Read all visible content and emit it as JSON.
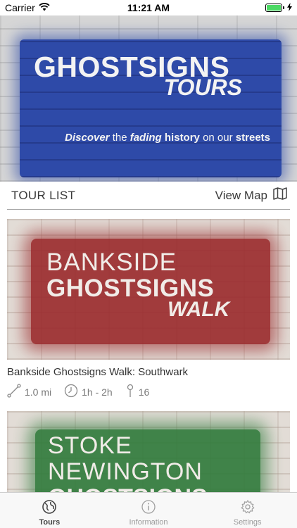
{
  "status_bar": {
    "carrier": "Carrier",
    "time": "11:21 AM",
    "battery_percent": 100
  },
  "hero": {
    "title": "GHOSTSIGNS",
    "subtitle": "TOURS",
    "tagline": {
      "w1": "Discover",
      "w2": "the",
      "w3": "fading",
      "w4": "history",
      "w5": "on our",
      "w6": "streets"
    },
    "paint_color": "#2e4aa8"
  },
  "section": {
    "title": "TOUR LIST",
    "view_map_label": "View Map"
  },
  "tours": [
    {
      "image_lines": [
        "BANKSIDE",
        "GHOSTSIGNS",
        "WALK"
      ],
      "paint_color": "#9a2a2c",
      "name": "Bankside Ghostsigns Walk: Southwark",
      "distance": "1.0 mi",
      "duration": "1h - 2h",
      "stops": "16"
    },
    {
      "image_lines": [
        "STOKE",
        "NEWINGTON",
        "GHOSTSIGNS"
      ],
      "paint_color": "#2f7a3a"
    }
  ],
  "tab_bar": {
    "tabs": [
      "Tours",
      "Information",
      "Settings"
    ],
    "active": "Tours"
  }
}
